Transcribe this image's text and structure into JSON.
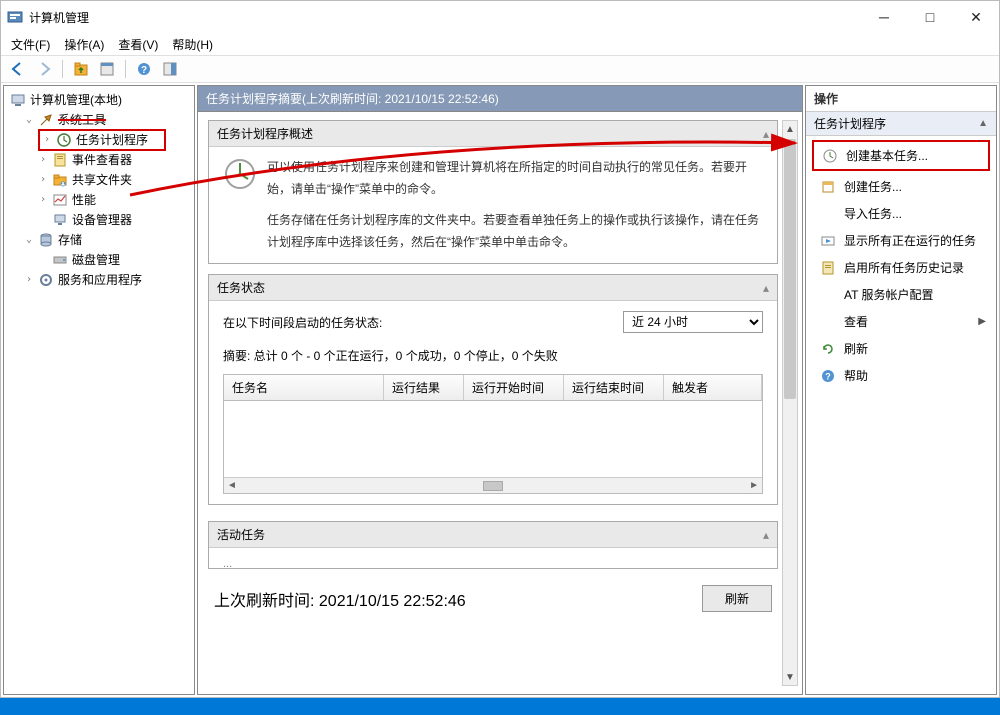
{
  "window": {
    "title": "计算机管理"
  },
  "menu": {
    "file": "文件(F)",
    "action": "操作(A)",
    "view": "查看(V)",
    "help": "帮助(H)"
  },
  "tree": {
    "root": "计算机管理(本地)",
    "sys_tools": "系统工具",
    "task_scheduler": "任务计划程序",
    "event_viewer": "事件查看器",
    "shared_folders": "共享文件夹",
    "performance": "性能",
    "device_mgr": "设备管理器",
    "storage": "存储",
    "disk_mgmt": "磁盘管理",
    "services": "服务和应用程序"
  },
  "main": {
    "header": "任务计划程序摘要(上次刷新时间: 2021/10/15 22:52:46)",
    "overview_title": "任务计划程序概述",
    "overview_p1": "可以使用任务计划程序来创建和管理计算机将在所指定的时间自动执行的常见任务。若要开始，请单击“操作”菜单中的命令。",
    "overview_p2": "任务存储在任务计划程序库的文件夹中。若要查看单独任务上的操作或执行该操作，请在任务计划程序库中选择该任务，然后在“操作”菜单中单击命令。",
    "status_title": "任务状态",
    "status_label": "在以下时间段启动的任务状态:",
    "status_dropdown": "近 24 小时",
    "status_summary": "摘要: 总计 0 个 - 0 个正在运行，0 个成功，0 个停止，0 个失败",
    "cols": {
      "name": "任务名",
      "result": "运行结果",
      "start": "运行开始时间",
      "end": "运行结束时间",
      "trigger": "触发者"
    },
    "active_title": "活动任务",
    "footer_time": "上次刷新时间: 2021/10/15 22:52:46",
    "refresh_btn": "刷新"
  },
  "actions": {
    "header": "操作",
    "section": "任务计划程序",
    "create_basic": "创建基本任务...",
    "create_task": "创建任务...",
    "import": "导入任务...",
    "show_running": "显示所有正在运行的任务",
    "enable_history": "启用所有任务历史记录",
    "at_config": "AT 服务帐户配置",
    "view": "查看",
    "refresh": "刷新",
    "help": "帮助"
  }
}
